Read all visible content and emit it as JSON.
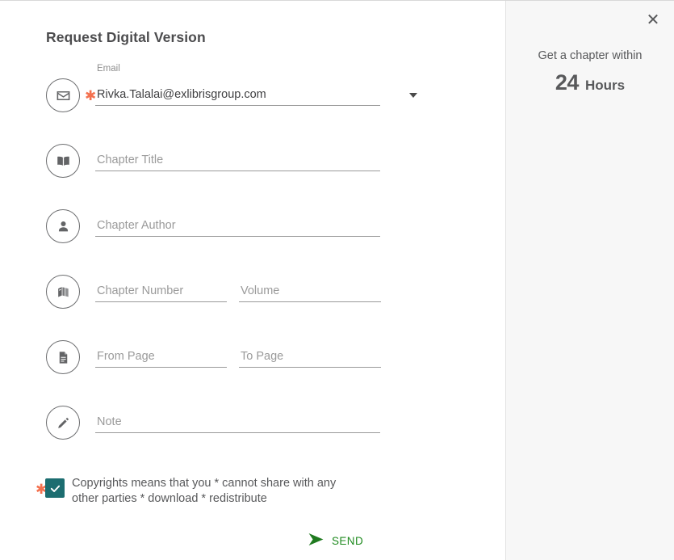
{
  "form": {
    "title": "Request Digital Version",
    "fields": [
      {
        "name": "email",
        "icon": "envelope-icon",
        "label": "Email",
        "value": "Rivka.Talalai@exlibrisgroup.com",
        "required": true,
        "has_dropdown": true
      },
      {
        "name": "chapter-title",
        "icon": "open-book-icon",
        "placeholder": "Chapter Title",
        "required": false
      },
      {
        "name": "chapter-author",
        "icon": "person-icon",
        "placeholder": "Chapter Author",
        "required": false
      },
      {
        "name": "chapter-number",
        "icon": "books-stack-icon",
        "placeholder": "Chapter Number",
        "placeholder_secondary": "Volume",
        "required": false
      },
      {
        "name": "from-page",
        "icon": "document-icon",
        "placeholder": "From Page",
        "placeholder_secondary": "To Page",
        "required": false
      },
      {
        "name": "note",
        "icon": "pencil-icon",
        "placeholder": "Note",
        "required": false
      }
    ],
    "consent": {
      "required_marker": "*",
      "checked": true,
      "text": "Copyrights means that you * cannot share with any other parties * download * redistribute"
    },
    "send_label": "SEND"
  },
  "side_panel": {
    "close_label": "✕",
    "promo_text": "Get a chapter within",
    "promo_number": "24",
    "promo_unit": "Hours"
  },
  "colors": {
    "checkbox_teal": "#1c6d70",
    "required_star": "#f4714f",
    "send_green": "#1e8a1e",
    "text_gray": "#58595b",
    "panel_bg": "#f7f7f7"
  }
}
